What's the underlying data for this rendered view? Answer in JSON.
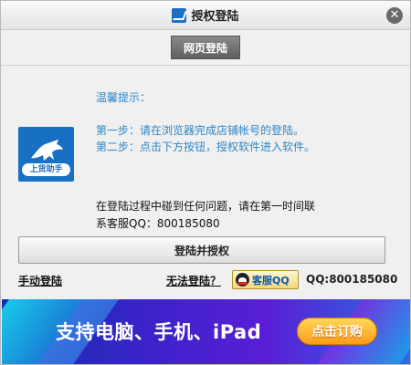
{
  "window": {
    "title": "授权登陆"
  },
  "tabs": [
    {
      "label": "网页登陆"
    }
  ],
  "logo": {
    "brand_text": "上货助手"
  },
  "tips": {
    "title": "温馨提示：",
    "step1": "第一步：请在浏览器完成店铺帐号的登陆。",
    "step2": "第二步：点击下方按钮，授权软件进入软件。"
  },
  "help": {
    "line1": "在登陆过程中碰到任何问题，请在第一时间联",
    "line2": "系客服QQ：800185080"
  },
  "actions": {
    "login_authorize": "登陆并授权",
    "manual_login": "手动登陆",
    "cannot_login": "无法登陆？",
    "qq_service": "客服QQ",
    "qq_number": "QQ:800185080"
  },
  "banner": {
    "text": "支持电脑、手机、iPad",
    "button": "点击订购"
  },
  "colors": {
    "tip_text": "#2a86c9",
    "accent_blue": "#1770c3",
    "banner_button": "#ff9b17"
  }
}
